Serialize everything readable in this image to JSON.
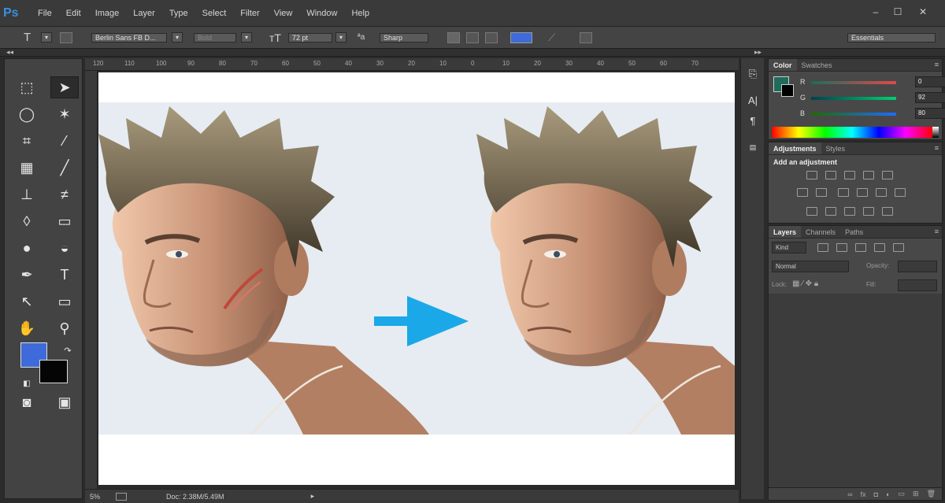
{
  "app": {
    "logo": "Ps"
  },
  "menu": [
    "File",
    "Edit",
    "Image",
    "Layer",
    "Type",
    "Select",
    "Filter",
    "View",
    "Window",
    "Help"
  ],
  "window_controls": [
    "–",
    "☐",
    "✕"
  ],
  "options_bar": {
    "tool_glyph": "T",
    "font_family": "Berlin Sans FB D...",
    "font_style": "Bold",
    "font_size": "72 pt",
    "antialias": "Sharp",
    "workspace": "Essentials"
  },
  "strip": {
    "collapse_left": "◂◂",
    "collapse_right": "▸▸"
  },
  "ruler_ticks": [
    "120",
    "110",
    "100",
    "90",
    "80",
    "70",
    "60",
    "50",
    "40",
    "30",
    "20",
    "10",
    "0",
    "10",
    "20",
    "30",
    "40",
    "50",
    "60",
    "70"
  ],
  "colors": {
    "foreground": "#3e6bd9",
    "background": "#050505",
    "panel_swatch": "#1f6b5c",
    "arrow": "#1aa8e8"
  },
  "status": {
    "zoom": "5%",
    "doc": "Doc: 2.38M/5.49M"
  },
  "color_panel": {
    "tabs": [
      "Color",
      "Swatches"
    ],
    "sliders": [
      {
        "label": "R",
        "value": "0"
      },
      {
        "label": "G",
        "value": "92"
      },
      {
        "label": "B",
        "value": "80"
      }
    ]
  },
  "adjustments_panel": {
    "tabs": [
      "Adjustments",
      "Styles"
    ],
    "heading": "Add an adjustment"
  },
  "layers_panel": {
    "tabs": [
      "Layers",
      "Channels",
      "Paths"
    ],
    "kind": "Kind",
    "blend_mode": "Normal",
    "opacity_label": "Opacity:",
    "lock_label": "Lock:",
    "fill_label": "Fill:"
  },
  "icons": {
    "tools": [
      "rect-marquee",
      "move",
      "lasso",
      "magic-wand",
      "crop",
      "eyedropper",
      "spot-healing",
      "brush",
      "clone-stamp",
      "history-brush",
      "eraser",
      "gradient",
      "blur",
      "dodge",
      "pen",
      "type",
      "path-select",
      "rectangle",
      "hand",
      "zoom",
      "quick-mask",
      "screen-mode"
    ]
  }
}
